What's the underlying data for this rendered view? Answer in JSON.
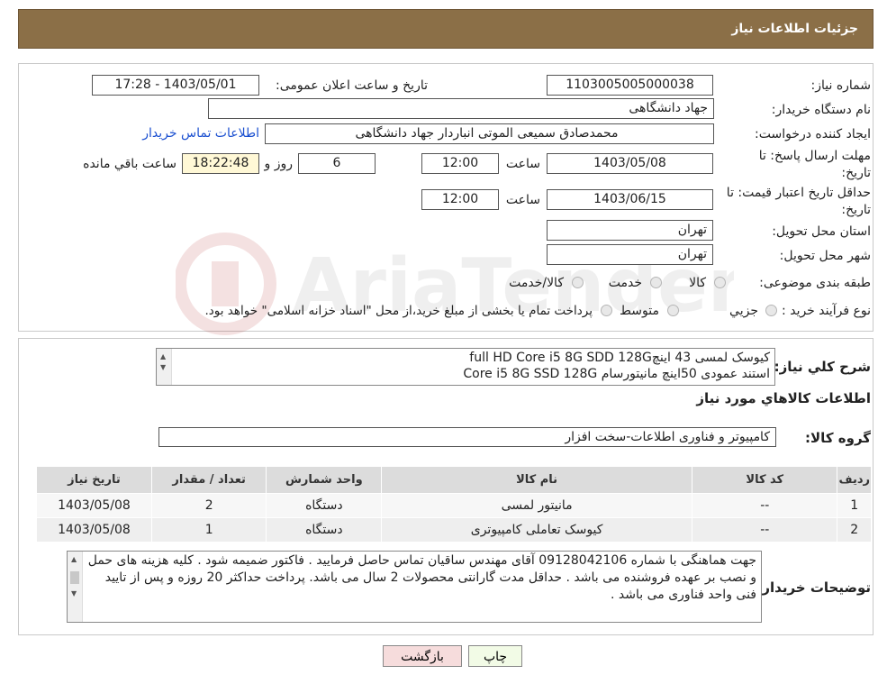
{
  "header": {
    "title": "جزئیات اطلاعات نیاز"
  },
  "form": {
    "need_number_label": "شماره نیاز:",
    "need_number": "1103005005000038",
    "announce_label": "تاریخ و ساعت اعلان عمومی:",
    "announce_value": "1403/05/01 - 17:28",
    "buyer_org_label": "نام دستگاه خریدار:",
    "buyer_org": "جهاد دانشگاهی",
    "creator_label": "ایجاد کننده درخواست:",
    "creator": "محمدصادق سمیعی الموتی انباردار جهاد دانشگاهی",
    "contact_link": "اطلاعات تماس خریدار",
    "deadline_label_1": "مهلت ارسال پاسخ: تا",
    "deadline_label_2": "تاریخ:",
    "deadline_date": "1403/05/08",
    "time_label": "ساعت",
    "deadline_time": "12:00",
    "days_value": "6",
    "days_label": "روز و",
    "remaining_time": "18:22:48",
    "remaining_label": "ساعت باقي مانده",
    "price_valid_label_1": "حداقل تاریخ اعتبار قیمت: تا",
    "price_valid_label_2": "تاریخ:",
    "price_valid_date": "1403/06/15",
    "price_valid_time": "12:00",
    "province_label": "استان محل تحویل:",
    "province": "تهران",
    "city_label": "شهر محل تحویل:",
    "city": "تهران",
    "category_label": "طبقه بندی موضوعی:",
    "category_options": [
      "کالا",
      "خدمت",
      "کالا/خدمت"
    ],
    "purchase_type_label": "نوع فرآیند خرید :",
    "purchase_options": [
      "جزیي",
      "متوسط"
    ],
    "purchase_note": "پرداخت تمام یا بخشی از مبلغ خرید،از محل \"اسناد خزانه اسلامی\" خواهد بود."
  },
  "summary": {
    "label": "شرح کلي نياز:",
    "line1": "کیوسک لمسی 43 اینچfull HD Core i5 8G SDD 128G",
    "line2": "استند عمودی 50اینچ مانیتورسام Core i5 8G  SSD 128G"
  },
  "goods": {
    "section_title": "اطلاعات کالاهاي مورد نياز",
    "group_label": "گروه کالا:",
    "group_value": "کامپیوتر و فناوری اطلاعات-سخت افزار",
    "columns": [
      "رديف",
      "کد کالا",
      "نام کالا",
      "واحد شمارش",
      "تعداد / مقدار",
      "تاريخ نياز"
    ],
    "rows": [
      {
        "idx": "1",
        "code": "--",
        "name": "مانیتور لمسی",
        "unit": "دستگاه",
        "qty": "2",
        "date": "1403/05/08"
      },
      {
        "idx": "2",
        "code": "--",
        "name": "کیوسک تعاملی کامپیوتری",
        "unit": "دستگاه",
        "qty": "1",
        "date": "1403/05/08"
      }
    ]
  },
  "buyer_notes": {
    "label": "توضيحات خريدار:",
    "text": "جهت هماهنگی با شماره 09128042106 آقای مهندس ساقیان تماس حاصل فرمایید . فاکتور ضمیمه شود . کلیه هزینه های حمل و نصب بر عهده فروشنده می باشد . حداقل مدت گارانتی محصولات 2 سال می باشد. پرداخت حداکثر 20 روزه و پس از تایید فنی واحد فناوری می باشد ."
  },
  "buttons": {
    "print": "چاپ",
    "back": "بازگشت"
  },
  "colors": {
    "header": "#8b6f47",
    "back_button": "#f6dcdc",
    "print_button": "#f2fbe6"
  }
}
